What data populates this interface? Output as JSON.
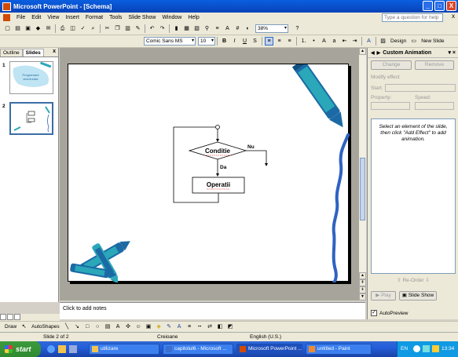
{
  "window": {
    "title": "Microsoft PowerPoint - [Schema]",
    "controls": [
      "_",
      "□",
      "X"
    ]
  },
  "menubar": {
    "items": [
      "File",
      "Edit",
      "View",
      "Insert",
      "Format",
      "Tools",
      "Slide Show",
      "Window",
      "Help"
    ],
    "help_placeholder": "Type a question for help",
    "close": "x"
  },
  "toolbar": {
    "zoom": "38%",
    "font_name": "Comic Sans MS",
    "font_size": "10",
    "bold": "B",
    "italic": "I",
    "underline": "U",
    "shadow": "S",
    "design_label": "Design",
    "new_slide_label": "New Slide"
  },
  "outline_pane": {
    "tabs": [
      "Outline",
      "Slides"
    ],
    "active_tab": "Slides",
    "close": "x",
    "slides": [
      {
        "number": "1",
        "caption": "Programare structurata"
      },
      {
        "number": "2",
        "caption": ""
      }
    ]
  },
  "slide": {
    "condition_label": "Conditie",
    "no_label": "Nu",
    "yes_label": "Da",
    "operation_label": "Operatii"
  },
  "notes": {
    "placeholder": "Click to add notes"
  },
  "task_pane": {
    "title": "Custom Animation",
    "change_label": "Change",
    "remove_label": "Remove",
    "modify_effect_label": "Modify effect",
    "start_label": "Start:",
    "property_label": "Property:",
    "speed_label": "Speed:",
    "list_hint": "Select an element of the slide, then click \"Add Effect\" to add animation.",
    "reorder_label": "Re-Order",
    "play_label": "Play",
    "slideshow_label": "Slide Show",
    "autopreview_label": "AutoPreview",
    "autopreview_checked": true
  },
  "drawing_toolbar": {
    "draw_label": "Draw",
    "autoshapes_label": "AutoShapes"
  },
  "statusbar": {
    "slide_info": "Slide 2 of 2",
    "design": "Creioane",
    "language": "English (U.S.)"
  },
  "taskbar": {
    "start_label": "start",
    "items": [
      {
        "label": "utilizare",
        "active": false
      },
      {
        "label": "capitolul6 - Microsoft ...",
        "active": false
      },
      {
        "label": "Microsoft PowerPoint ...",
        "active": true
      },
      {
        "label": "untitled - Paint",
        "active": false
      }
    ],
    "language": "EN",
    "clock": "13:34"
  },
  "colors": {
    "titlebar": "#0a5fe0",
    "crayon_blue": "#1b6aa5",
    "crayon_teal": "#2aa7b8",
    "scribble_blue": "#2f62c2"
  }
}
